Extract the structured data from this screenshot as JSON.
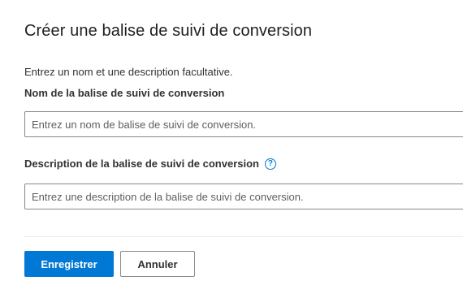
{
  "dialog": {
    "title": "Créer une balise de suivi de conversion",
    "intro": "Entrez un nom et une description facultative."
  },
  "name_field": {
    "label": "Nom de la balise de suivi de conversion",
    "value": "",
    "placeholder": "Entrez un nom de balise de suivi de conversion."
  },
  "description_field": {
    "label": "Description de la balise de suivi de conversion",
    "help_icon": "question-circle-icon",
    "help_glyph": "?",
    "value": "",
    "placeholder": "Entrez une description de la balise de suivi de conversion."
  },
  "actions": {
    "save_label": "Enregistrer",
    "cancel_label": "Annuler"
  },
  "colors": {
    "primary": "#0078d4",
    "text": "#323130",
    "border": "#8a8886",
    "divider": "#edebe9"
  }
}
